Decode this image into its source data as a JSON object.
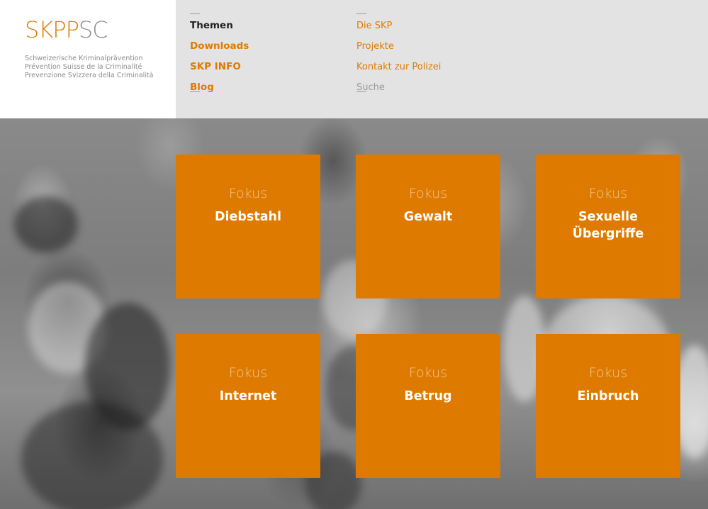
{
  "logo": {
    "part1": "SKPP",
    "part2": "SC",
    "taglines": [
      "Schweizerische Kriminalprävention",
      "Prévention Suisse de la Criminalité",
      "Prevenzione Svizzera della Criminalità"
    ]
  },
  "nav": {
    "primary": [
      {
        "label": "Themen",
        "active": true
      },
      {
        "label": "Downloads",
        "active": false
      },
      {
        "label": "SKP INFO",
        "active": false
      },
      {
        "label": "Blog",
        "active": false
      }
    ],
    "secondary": [
      {
        "label": "Die SKP"
      },
      {
        "label": "Projekte"
      },
      {
        "label": "Kontakt zur Polizei"
      },
      {
        "label": "Suche"
      }
    ]
  },
  "tiles": [
    {
      "kicker": "Fokus",
      "title": "Diebstahl"
    },
    {
      "kicker": "Fokus",
      "title": "Gewalt"
    },
    {
      "kicker": "Fokus",
      "title": "Sexuelle Übergriffe"
    },
    {
      "kicker": "Fokus",
      "title": "Internet"
    },
    {
      "kicker": "Fokus",
      "title": "Betrug"
    },
    {
      "kicker": "Fokus",
      "title": "Einbruch"
    }
  ],
  "colors": {
    "brand_orange": "#df7a00",
    "nav_background": "#e3e3e3",
    "logo_gray": "#8c8c8c"
  }
}
